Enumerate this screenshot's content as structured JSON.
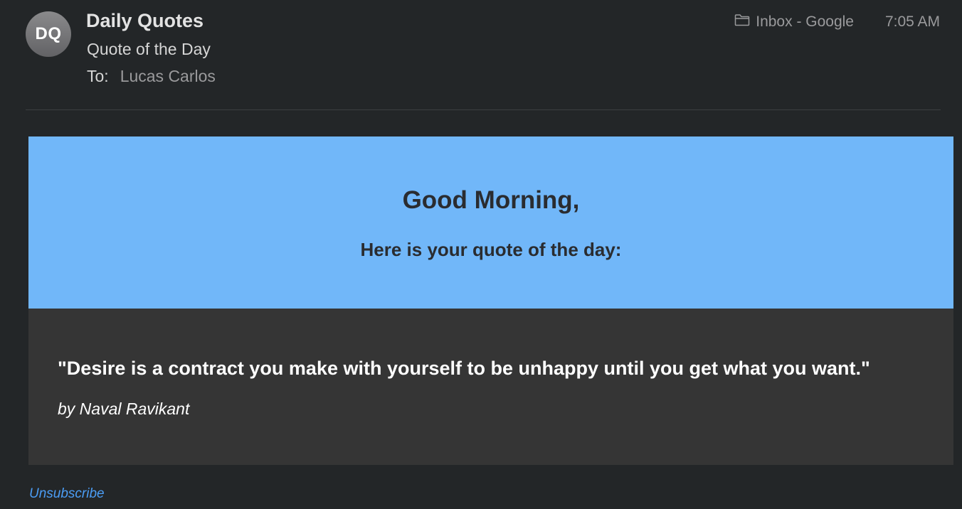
{
  "header": {
    "avatar_initials": "DQ",
    "sender": "Daily Quotes",
    "subject": "Quote of the Day",
    "to_label": "To:",
    "recipient": "Lucas Carlos",
    "mailbox": "Inbox - Google",
    "mailbox_icon": "folder-icon",
    "time": "7:05 AM"
  },
  "email": {
    "greeting": "Good Morning,",
    "intro": "Here is your quote of the day:",
    "quote": "\"Desire is a contract you make with yourself to be unhappy until you get what you want.\"",
    "author": "by Naval Ravikant",
    "unsubscribe": "Unsubscribe"
  },
  "colors": {
    "background": "#232628",
    "hero": "#71b7f9",
    "quote_box": "#353535",
    "link": "#4b9df5"
  }
}
